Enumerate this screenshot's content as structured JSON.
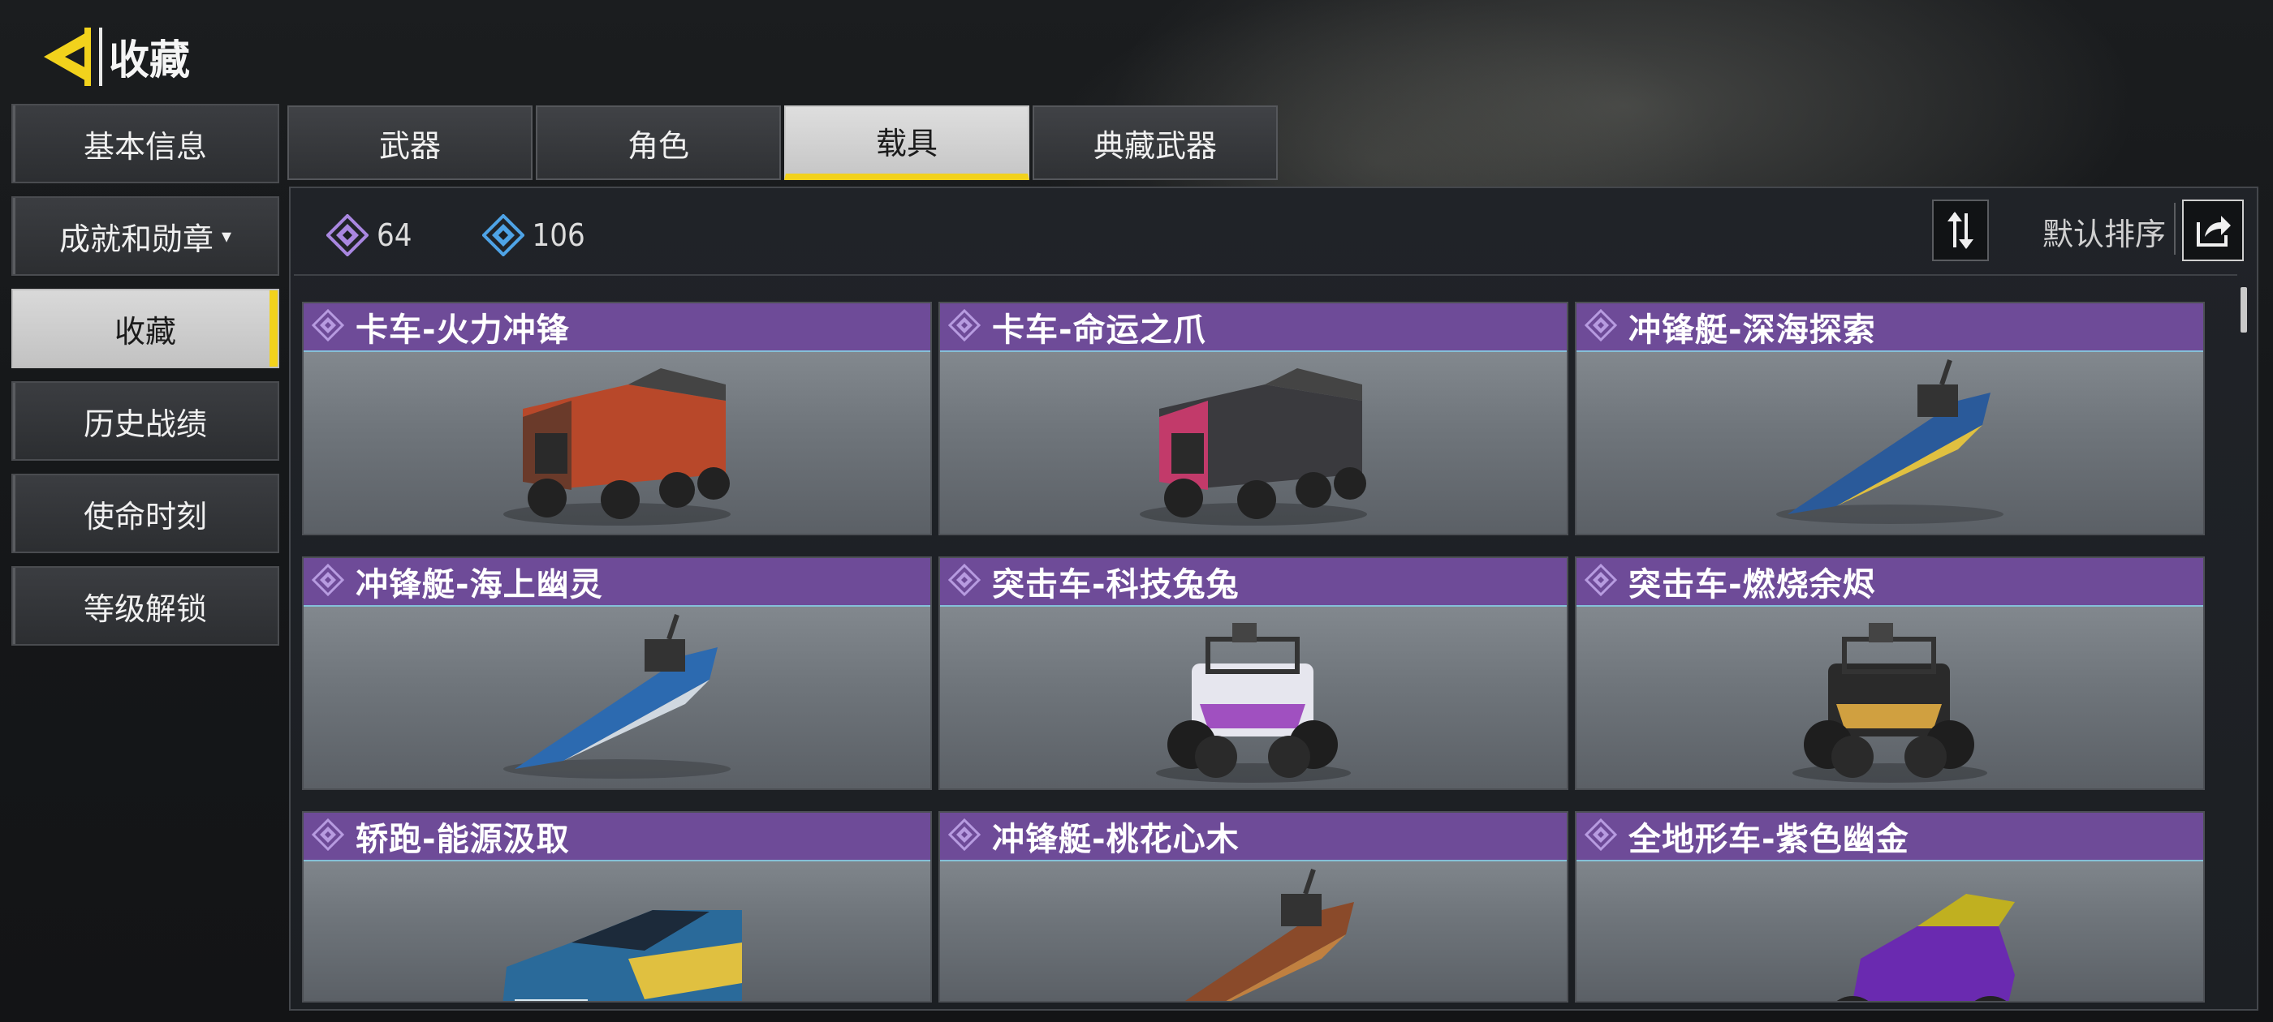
{
  "header": {
    "title": "收藏",
    "back_icon": "back-arrow-icon"
  },
  "sidebar": {
    "items": [
      {
        "label": "基本信息"
      },
      {
        "label": "成就和勋章",
        "caret": "▾"
      },
      {
        "label": "收藏"
      },
      {
        "label": "历史战绩"
      },
      {
        "label": "使命时刻"
      },
      {
        "label": "等级解锁"
      }
    ],
    "active_index": 2
  },
  "tabs": {
    "items": [
      {
        "label": "武器"
      },
      {
        "label": "角色"
      },
      {
        "label": "载具"
      },
      {
        "label": "典藏武器"
      }
    ],
    "active_index": 2
  },
  "stats": {
    "legendary_count": "64",
    "epic_count": "106",
    "legendary_icon": "purple-diamond-icon",
    "epic_icon": "blue-diamond-icon"
  },
  "sort": {
    "label": "默认排序",
    "sort_icon": "sort-arrows-icon",
    "share_icon": "share-icon"
  },
  "colors": {
    "accent": "#f2d21c",
    "card_header": "#6e4b98",
    "rarity_purple": "#a987e0",
    "rarity_blue": "#4ea3e6"
  },
  "vehicles": [
    {
      "name": "卡车-火力冲锋",
      "type": "truck"
    },
    {
      "name": "卡车-命运之爪",
      "type": "truck"
    },
    {
      "name": "冲锋艇-深海探索",
      "type": "boat"
    },
    {
      "name": "冲锋艇-海上幽灵",
      "type": "boat"
    },
    {
      "name": "突击车-科技兔兔",
      "type": "buggy"
    },
    {
      "name": "突击车-燃烧余烬",
      "type": "buggy"
    },
    {
      "name": "轿跑-能源汲取",
      "type": "car"
    },
    {
      "name": "冲锋艇-桃花心木",
      "type": "boat"
    },
    {
      "name": "全地形车-紫色幽金",
      "type": "atv"
    }
  ]
}
